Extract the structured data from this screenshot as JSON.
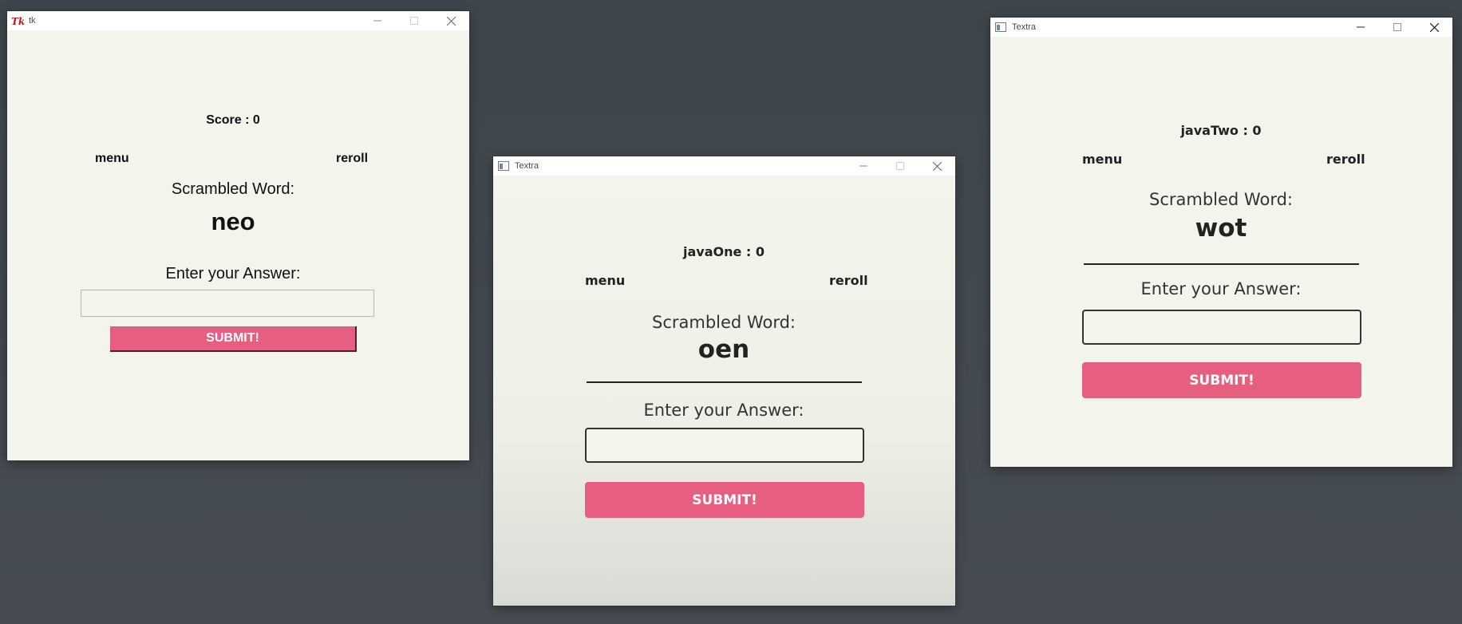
{
  "windows": {
    "tk": {
      "title": "tk",
      "score": "Score : 0",
      "menu": "menu",
      "reroll": "reroll",
      "scrambled_label": "Scrambled Word:",
      "scrambled_word": "neo",
      "answer_label": "Enter your Answer:",
      "answer_value": "",
      "submit": "SUBMIT!"
    },
    "javaOne": {
      "title": "Textra",
      "score": "javaOne : 0",
      "menu": "menu",
      "reroll": "reroll",
      "scrambled_label": "Scrambled Word:",
      "scrambled_word": "oen",
      "answer_label": "Enter your Answer:",
      "answer_value": "",
      "submit": "SUBMIT!"
    },
    "javaTwo": {
      "title": "Textra",
      "score": "javaTwo : 0",
      "menu": "menu",
      "reroll": "reroll",
      "scrambled_label": "Scrambled Word:",
      "scrambled_word": "wot",
      "answer_label": "Enter your Answer:",
      "answer_value": "",
      "submit": "SUBMIT!"
    }
  },
  "colors": {
    "desktop": "#434a50",
    "window_bg": "#f3f5ec",
    "submit_bg": "#e65e80",
    "submit_text": "#ffffff"
  },
  "icons": {
    "tk_title_icon": "tk-feather-icon",
    "textra_title_icon": "window-app-icon",
    "minimize": "minimize-icon",
    "maximize": "maximize-icon",
    "close": "close-icon"
  }
}
